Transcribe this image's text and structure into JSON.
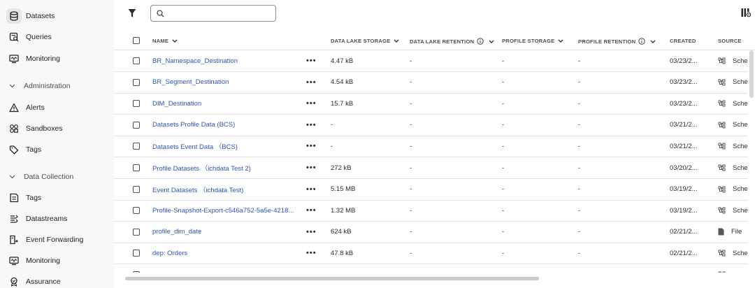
{
  "sidebar": {
    "items_top": [
      {
        "label": "Datasets",
        "icon": "database-icon",
        "active": true
      },
      {
        "label": "Queries",
        "icon": "query-icon"
      },
      {
        "label": "Monitoring",
        "icon": "monitor-icon"
      }
    ],
    "section_admin": {
      "label": "Administration",
      "icon": "chevron-down-icon"
    },
    "items_admin": [
      {
        "label": "Alerts",
        "icon": "alert-icon"
      },
      {
        "label": "Sandboxes",
        "icon": "sandbox-icon"
      },
      {
        "label": "Tags",
        "icon": "tag-icon"
      }
    ],
    "section_data": {
      "label": "Data Collection",
      "icon": "chevron-down-icon"
    },
    "items_data": [
      {
        "label": "Tags",
        "icon": "tags-box-icon"
      },
      {
        "label": "Datastreams",
        "icon": "datastream-icon"
      },
      {
        "label": "Event Forwarding",
        "icon": "event-forwarding-icon"
      },
      {
        "label": "Monitoring",
        "icon": "monitor-icon"
      },
      {
        "label": "Assurance",
        "icon": "assurance-icon"
      }
    ]
  },
  "search": {
    "value": "",
    "placeholder": ""
  },
  "columns": {
    "name": "NAME",
    "lake_storage": "DATA LAKE STORAGE",
    "lake_retention": "DATA LAKE RETENTION",
    "profile_storage": "PROFILE STORAGE",
    "profile_retention": "PROFILE RETENTION",
    "created": "CREATED",
    "source": "SOURCE"
  },
  "rows": [
    {
      "name": "BR_Namespace_Destination",
      "menu": "•••",
      "lake_storage": "4.47 kB",
      "lake_retention": "-",
      "profile_storage": "-",
      "profile_retention": "-",
      "created": "03/23/2...",
      "source": "Schem",
      "source_icon": "schema-icon"
    },
    {
      "name": "BR_Segment_Destination",
      "menu": "•••",
      "lake_storage": "4.54 kB",
      "lake_retention": "-",
      "profile_storage": "-",
      "profile_retention": "-",
      "created": "03/23/2...",
      "source": "Schem",
      "source_icon": "schema-icon"
    },
    {
      "name": "DIM_Destination",
      "menu": "•••",
      "lake_storage": "15.7 kB",
      "lake_retention": "-",
      "profile_storage": "-",
      "profile_retention": "-",
      "created": "03/23/2...",
      "source": "Schem",
      "source_icon": "schema-icon"
    },
    {
      "name": "Datasets Profile Data (BCS)",
      "menu": "•••",
      "lake_storage": "-",
      "lake_retention": "-",
      "profile_storage": "-",
      "profile_retention": "-",
      "created": "03/21/2...",
      "source": "Schem",
      "source_icon": "schema-icon"
    },
    {
      "name": "Datasets Event Data （BCS)",
      "menu": "•••",
      "lake_storage": "-",
      "lake_retention": "-",
      "profile_storage": "-",
      "profile_retention": "-",
      "created": "03/21/2...",
      "source": "Schem",
      "source_icon": "schema-icon"
    },
    {
      "name": "Profile Datasets （ichdata Test 2)",
      "menu": "•••",
      "lake_storage": "272 kB",
      "lake_retention": "-",
      "profile_storage": "-",
      "profile_retention": "-",
      "created": "03/20/2...",
      "source": "Schem",
      "source_icon": "schema-icon"
    },
    {
      "name": "Event Datasets （ichdata Test)",
      "menu": "•••",
      "lake_storage": "5.15 MB",
      "lake_retention": "-",
      "profile_storage": "-",
      "profile_retention": "-",
      "created": "03/19/2...",
      "source": "Schem",
      "source_icon": "schema-icon"
    },
    {
      "name": "Profile-Snapshot-Export-c546a752-5a5e-4218...",
      "menu": "•••",
      "lake_storage": "1.32 MB",
      "lake_retention": "-",
      "profile_storage": "-",
      "profile_retention": "-",
      "created": "03/19/2...",
      "source": "Schem",
      "source_icon": "schema-icon"
    },
    {
      "name": "profile_dim_date",
      "menu": "•••",
      "lake_storage": "624 kB",
      "lake_retention": "-",
      "profile_storage": "-",
      "profile_retention": "-",
      "created": "02/21/2...",
      "source": "File",
      "source_icon": "file-icon"
    },
    {
      "name": "dep: Orders",
      "menu": "•••",
      "lake_storage": "47.8 kB",
      "lake_retention": "-",
      "profile_storage": "-",
      "profile_retention": "-",
      "created": "02/21/2...",
      "source": "Schem",
      "source_icon": "schema-icon"
    },
    {
      "name": "",
      "menu": "",
      "lake_storage": "",
      "lake_retention": "",
      "profile_storage": "",
      "profile_retention": "",
      "created": "",
      "source": "",
      "source_icon": "schema-icon"
    }
  ]
}
